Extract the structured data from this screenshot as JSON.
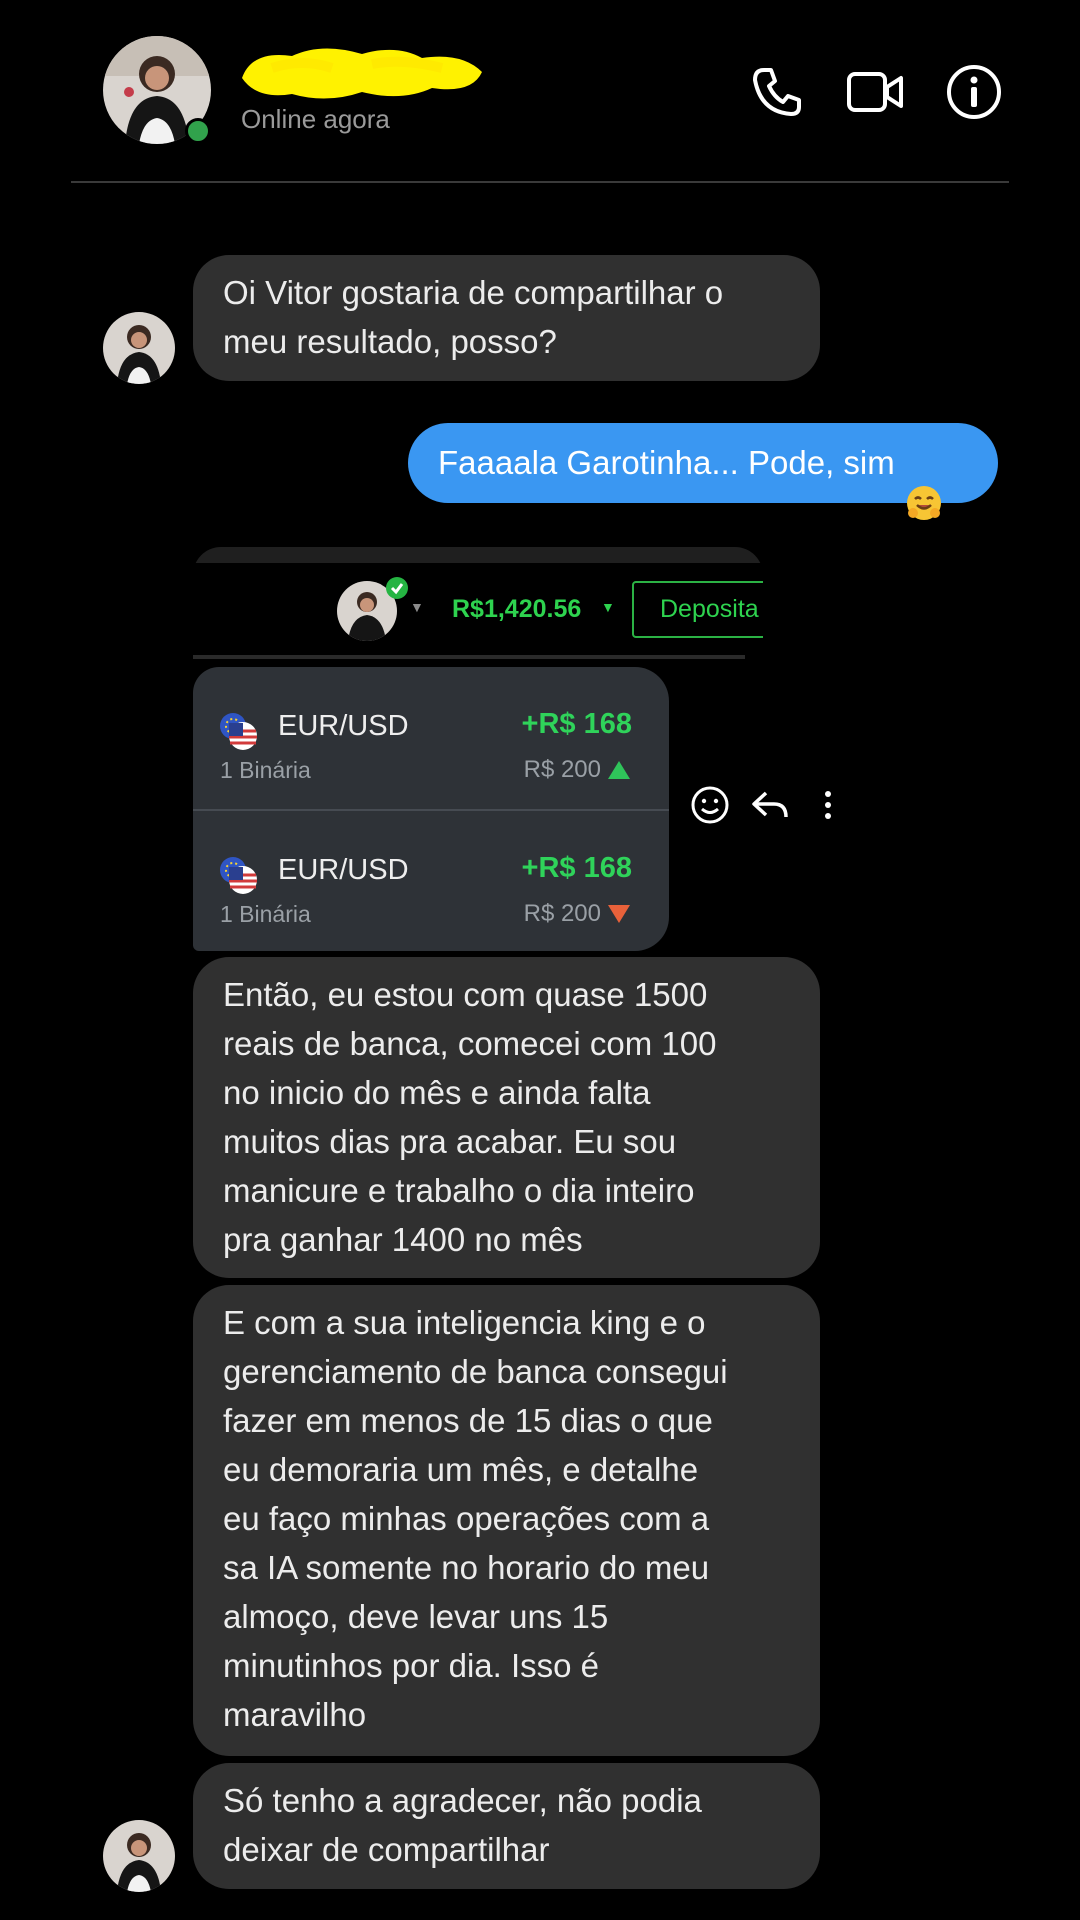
{
  "header": {
    "status": "Online agora",
    "icons": [
      "phone-icon",
      "video-call-icon",
      "info-icon"
    ],
    "online_color": "#31a24c"
  },
  "messages": [
    {
      "from": "contact",
      "text": "Oi Vitor gostaria de compartilhar o\nmeu resultado, posso?"
    },
    {
      "from": "me",
      "text": "Faaaala Garotinha... Pode, sim",
      "emoji": "hugging-face"
    },
    {
      "from": "contact",
      "type": "image"
    },
    {
      "from": "contact",
      "text": "Então, eu estou com quase 1500\nreais de banca, comecei com 100\nno inicio do mês e ainda falta\nmuitos dias pra acabar. Eu sou\nmanicure e trabalho o dia inteiro\npra ganhar 1400 no mês"
    },
    {
      "from": "contact",
      "text": "E com a sua inteligencia king e o\ngerenciamento de banca consegui\nfazer em menos de 15 dias o que\neu demoraria um mês, e detalhe\neu faço minhas operações com a\nsa IA somente no horario do meu\nalmoço, deve levar uns 15\nminutinhos por dia. Isso é\nmaravilho"
    },
    {
      "from": "contact",
      "text": "Só tenho a agradecer, não podia\ndeixar de compartilhar"
    }
  ],
  "shared_image": {
    "balance": "R$1,420.56",
    "deposit_label": "Deposita",
    "trades": [
      {
        "pair": "EUR/USD",
        "type": "1 Binária",
        "profit": "+R$ 168",
        "amount": "R$ 200",
        "direction": "up"
      },
      {
        "pair": "EUR/USD",
        "type": "1 Binária",
        "profit": "+R$ 168",
        "amount": "R$ 200",
        "direction": "down"
      }
    ]
  },
  "colors": {
    "background": "#000000",
    "received_bubble": "#303030",
    "sent_bubble": "#3a97f2",
    "profit_green": "#2fd35a",
    "arrow_up": "#2fc45a",
    "arrow_down": "#e8613a"
  }
}
